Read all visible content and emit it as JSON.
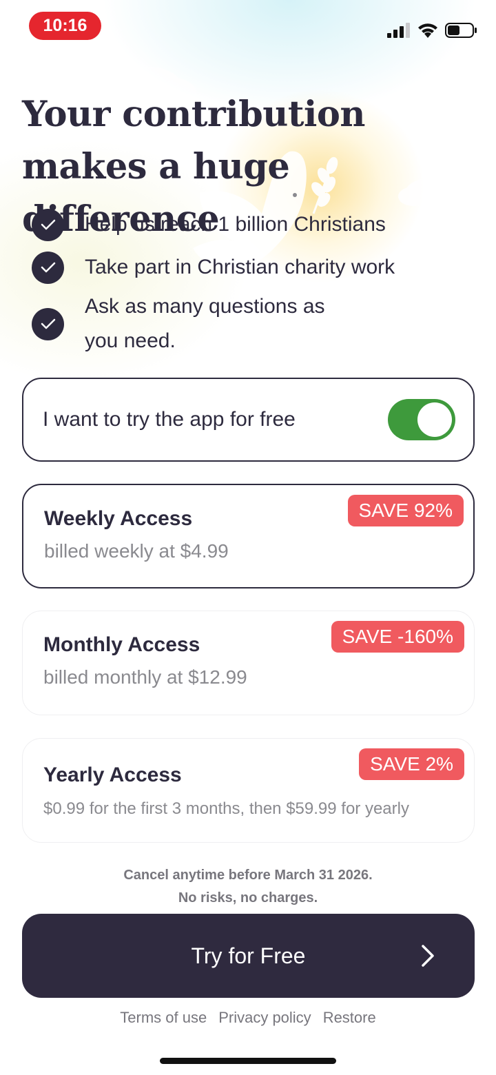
{
  "status_bar": {
    "time": "10:16"
  },
  "title": "Your contribution makes a huge difference",
  "features": [
    {
      "text": "Help us reach 1 billion Christians"
    },
    {
      "text": "Take part in Christian charity work"
    },
    {
      "text": "Ask as many questions as you need."
    }
  ],
  "free_trial": {
    "label": "I want to try the app for free",
    "enabled": true
  },
  "plans": [
    {
      "title": "Weekly Access",
      "subtitle": "billed weekly at $4.99",
      "badge": "SAVE 92%",
      "selected": true
    },
    {
      "title": "Monthly Access",
      "subtitle": "billed monthly at $12.99",
      "badge": "SAVE -160%",
      "selected": false
    },
    {
      "title": "Yearly Access",
      "subtitle": "$0.99 for the first 3 months, then $59.99 for yearly",
      "badge": "SAVE 2%",
      "selected": false
    }
  ],
  "note": {
    "line1": "Cancel anytime before March 31 2026.",
    "line2": "No risks, no charges."
  },
  "cta": {
    "label": "Try for Free"
  },
  "footer": {
    "terms": "Terms of use",
    "privacy": "Privacy policy",
    "restore": "Restore"
  },
  "colors": {
    "accent_dark": "#2d2a3e",
    "toggle_on": "#3e9a3c",
    "badge": "#f05a5f",
    "time_pill": "#e5262e"
  }
}
